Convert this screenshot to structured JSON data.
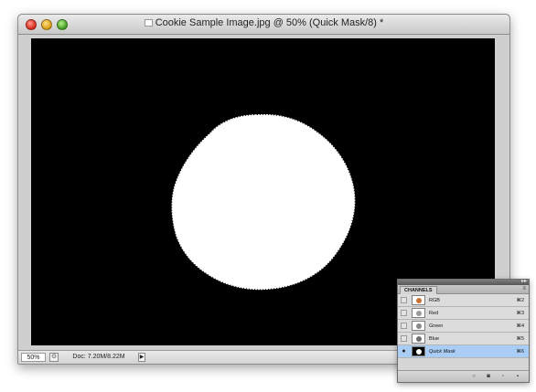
{
  "window": {
    "title": "Cookie Sample Image.jpg @ 50% (Quick Mask/8) *",
    "buttons": {
      "close_icon": "close-icon",
      "minimize_icon": "minimize-icon",
      "zoom_icon": "zoom-icon"
    }
  },
  "canvas": {
    "background_color": "#000000",
    "mask_color": "#ffffff"
  },
  "status_bar": {
    "zoom": "50%",
    "doc_size": "Doc: 7.20M/8.22M",
    "arrow_glyph": "▶"
  },
  "channels_panel": {
    "tab_label": "CHANNELS",
    "menu_glyph": "≡",
    "collapse_glyph": "▸▸",
    "channels": [
      {
        "name": "RGB",
        "shortcut": "⌘2",
        "visible": false,
        "thumb_color": "#c9712f"
      },
      {
        "name": "Red",
        "shortcut": "⌘3",
        "visible": false,
        "thumb_color": "#9a9a9a"
      },
      {
        "name": "Green",
        "shortcut": "⌘4",
        "visible": false,
        "thumb_color": "#8a8a8a"
      },
      {
        "name": "Blue",
        "shortcut": "⌘5",
        "visible": false,
        "thumb_color": "#6f6f6f"
      },
      {
        "name": "Quick Mask",
        "shortcut": "⌘6",
        "visible": true,
        "thumb_color": "#ffffff",
        "selected": true
      }
    ],
    "eye_glyph": "●",
    "footer_icons": [
      "load-selection-icon",
      "save-selection-icon",
      "new-channel-icon",
      "delete-channel-icon"
    ]
  }
}
